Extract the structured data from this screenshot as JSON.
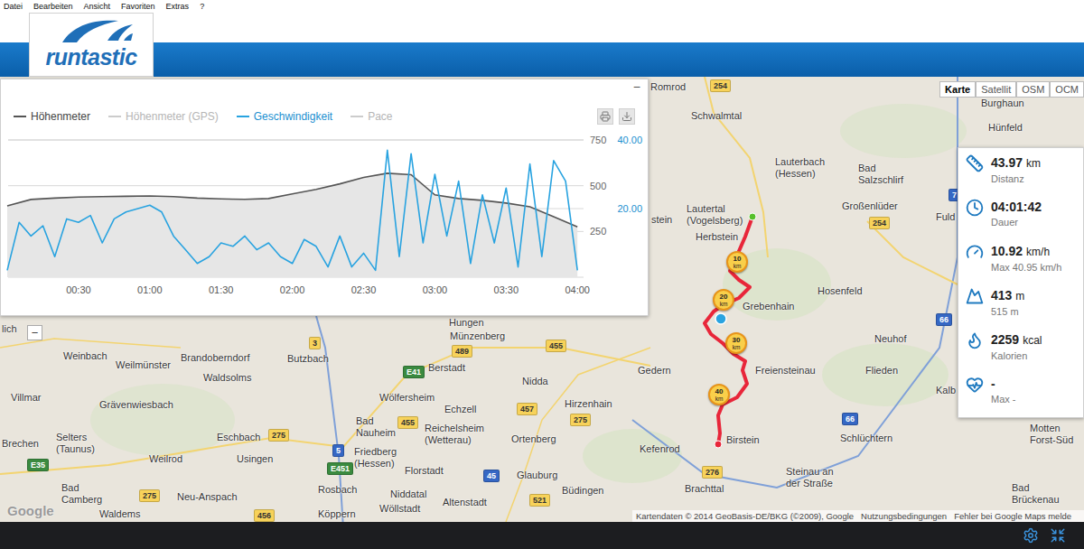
{
  "menu": [
    "Datei",
    "Bearbeiten",
    "Ansicht",
    "Favoriten",
    "Extras",
    "?"
  ],
  "logo": {
    "text": "runtastic"
  },
  "chart": {
    "minimize": "−",
    "legend": [
      {
        "label": "Höhenmeter",
        "active": true,
        "color": "#555555"
      },
      {
        "label": "Höhenmeter (GPS)",
        "active": false,
        "color": "#cccccc"
      },
      {
        "label": "Geschwindigkeit",
        "active": true,
        "color": "#29a3e0"
      },
      {
        "label": "Pace",
        "active": false,
        "color": "#cccccc"
      }
    ],
    "left_ticks": [
      "750",
      "500",
      "250"
    ],
    "right_ticks": [
      "40.00",
      "20.00"
    ],
    "x_ticks": [
      "00:30",
      "01:00",
      "01:30",
      "02:00",
      "02:30",
      "03:00",
      "03:30",
      "04:00"
    ],
    "series": [
      {
        "name": "elevation",
        "axis": "left",
        "interval_minutes": 10,
        "values": [
          390,
          425,
          432,
          438,
          440,
          442,
          444,
          440,
          432,
          428,
          426,
          430,
          455,
          480,
          510,
          545,
          568,
          560,
          450,
          430,
          420,
          405,
          385,
          330,
          275
        ]
      },
      {
        "name": "speed",
        "axis": "right",
        "interval_minutes": 5,
        "values": [
          2,
          16,
          12,
          15,
          6,
          17,
          16,
          18,
          10,
          17,
          19,
          20,
          21,
          19,
          12,
          8,
          4,
          6,
          10,
          9,
          12,
          8,
          10,
          6,
          4,
          11,
          9,
          3,
          12,
          3,
          7,
          2,
          37,
          6,
          36,
          10,
          30,
          12,
          28,
          4,
          24,
          10,
          26,
          3,
          33,
          6,
          34,
          28,
          2
        ]
      }
    ]
  },
  "map_types": [
    {
      "label": "Karte",
      "selected": true
    },
    {
      "label": "Satellit",
      "selected": false
    },
    {
      "label": "OSM",
      "selected": false
    },
    {
      "label": "OCM",
      "selected": false
    }
  ],
  "stats": [
    {
      "value": "43.97",
      "unit": "km",
      "label": "Distanz"
    },
    {
      "value": "04:01:42",
      "unit": "",
      "label": "Dauer"
    },
    {
      "value": "10.92",
      "unit": "km/h",
      "label": "Max 40.95 km/h"
    },
    {
      "value": "413",
      "unit": "m",
      "label": "515 m"
    },
    {
      "value": "2259",
      "unit": "kcal",
      "label": "Kalorien"
    },
    {
      "value": "-",
      "unit": "",
      "label": "Max -"
    }
  ],
  "map": {
    "zoom_out": "−",
    "google": "Google",
    "places": [
      {
        "lines": [
          "Romrod"
        ]
      },
      {
        "lines": [
          "Schwalmtal"
        ]
      },
      {
        "lines": [
          "Burghaun"
        ]
      },
      {
        "lines": [
          "Hünfeld"
        ]
      },
      {
        "lines": [
          "Lauterbach",
          "(Hessen)"
        ]
      },
      {
        "lines": [
          "Bad",
          "Salzschlirf"
        ]
      },
      {
        "lines": [
          "Großenlüder"
        ]
      },
      {
        "lines": [
          "stein"
        ]
      },
      {
        "lines": [
          "Lautertal",
          "(Vogelsberg)"
        ]
      },
      {
        "lines": [
          "Herbstein"
        ]
      },
      {
        "lines": [
          "Fuld"
        ]
      },
      {
        "lines": [
          "Grebenhain"
        ]
      },
      {
        "lines": [
          "Hosenfeld"
        ]
      },
      {
        "lines": [
          "Neuhof"
        ]
      },
      {
        "lines": [
          "lich"
        ]
      },
      {
        "lines": [
          "Hungen"
        ]
      },
      {
        "lines": [
          "Münzenberg"
        ]
      },
      {
        "lines": [
          "Weinbach"
        ]
      },
      {
        "lines": [
          "Weilmünster"
        ]
      },
      {
        "lines": [
          "Brandoberndorf"
        ]
      },
      {
        "lines": [
          "Butzbach"
        ]
      },
      {
        "lines": [
          "Berstadt"
        ]
      },
      {
        "lines": [
          "Nidda"
        ]
      },
      {
        "lines": [
          "Gedern"
        ]
      },
      {
        "lines": [
          "Freiensteinau"
        ]
      },
      {
        "lines": [
          "Flieden"
        ]
      },
      {
        "lines": [
          "Kalb"
        ]
      },
      {
        "lines": [
          "Waldsolms"
        ]
      },
      {
        "lines": [
          "Villmar"
        ]
      },
      {
        "lines": [
          "Grävenwiesbach"
        ]
      },
      {
        "lines": [
          "Wölfersheim"
        ]
      },
      {
        "lines": [
          "Echzell"
        ]
      },
      {
        "lines": [
          "Hirzenhain"
        ]
      },
      {
        "lines": [
          "Bad",
          "Nauheim"
        ]
      },
      {
        "lines": [
          "Reichelsheim",
          "(Wetterau)"
        ]
      },
      {
        "lines": [
          "Ortenberg"
        ]
      },
      {
        "lines": [
          "Birstein"
        ]
      },
      {
        "lines": [
          "Schlüchtern"
        ]
      },
      {
        "lines": [
          "Motten",
          "Forst-Süd"
        ]
      },
      {
        "lines": [
          "Brechen"
        ]
      },
      {
        "lines": [
          "Selters",
          "(Taunus)"
        ]
      },
      {
        "lines": [
          "Eschbach"
        ]
      },
      {
        "lines": [
          "Friedberg",
          "(Hessen)"
        ]
      },
      {
        "lines": [
          "Kefenrod"
        ]
      },
      {
        "lines": [
          "Weilrod"
        ]
      },
      {
        "lines": [
          "Usingen"
        ]
      },
      {
        "lines": [
          "Florstadt"
        ]
      },
      {
        "lines": [
          "Glauburg"
        ]
      },
      {
        "lines": [
          "Büdingen"
        ]
      },
      {
        "lines": [
          "Steinau an",
          "der Straße"
        ]
      },
      {
        "lines": [
          "Bad",
          "Brückenau"
        ]
      },
      {
        "lines": [
          "Bad",
          "Camberg"
        ]
      },
      {
        "lines": [
          "Brachttal"
        ]
      },
      {
        "lines": [
          "Neu-Anspach"
        ]
      },
      {
        "lines": [
          "Rosbach"
        ]
      },
      {
        "lines": [
          "Niddatal"
        ]
      },
      {
        "lines": [
          "Altenstadt"
        ]
      },
      {
        "lines": [
          "Waldems"
        ]
      },
      {
        "lines": [
          "Köppern"
        ]
      },
      {
        "lines": [
          "Wöllstadt"
        ]
      }
    ],
    "roads": [
      {
        "label": "254",
        "color": "#f7d25a"
      },
      {
        "label": "254",
        "color": "#f7d25a"
      },
      {
        "label": "7",
        "color": "#3567c4"
      },
      {
        "label": "66",
        "color": "#3567c4"
      },
      {
        "label": "3",
        "color": "#f7d25a"
      },
      {
        "label": "489",
        "color": "#f7d25a"
      },
      {
        "label": "455",
        "color": "#f7d25a"
      },
      {
        "label": "E41",
        "color": "#3a8a3f"
      },
      {
        "label": "455",
        "color": "#f7d25a"
      },
      {
        "label": "457",
        "color": "#f7d25a"
      },
      {
        "label": "275",
        "color": "#f7d25a"
      },
      {
        "label": "275",
        "color": "#f7d25a"
      },
      {
        "label": "5",
        "color": "#3567c4"
      },
      {
        "label": "E451",
        "color": "#3a8a3f"
      },
      {
        "label": "E35",
        "color": "#3a8a3f"
      },
      {
        "label": "45",
        "color": "#3567c4"
      },
      {
        "label": "275",
        "color": "#f7d25a"
      },
      {
        "label": "521",
        "color": "#f7d25a"
      },
      {
        "label": "456",
        "color": "#f7d25a"
      },
      {
        "label": "276",
        "color": "#f7d25a"
      },
      {
        "label": "66",
        "color": "#3567c4"
      }
    ],
    "markers": [
      {
        "value": "10",
        "unit": "km"
      },
      {
        "value": "20",
        "unit": "km"
      },
      {
        "value": "30",
        "unit": "km"
      },
      {
        "value": "40",
        "unit": "km"
      }
    ],
    "attribution": [
      "Kartendaten © 2014 GeoBasis-DE/BKG (©2009), Google",
      "Nutzungsbedingungen",
      "Fehler bei Google Maps melde"
    ]
  }
}
